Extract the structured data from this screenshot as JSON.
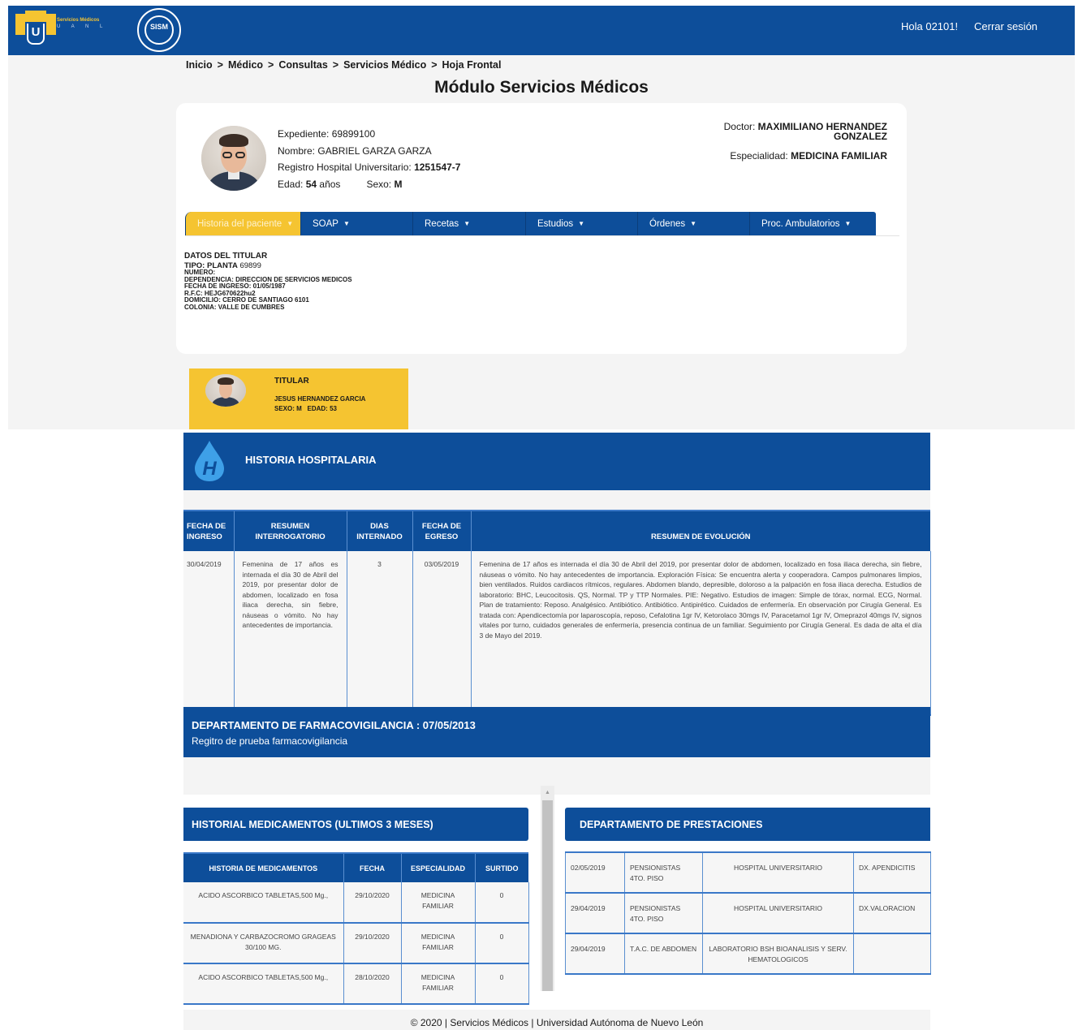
{
  "nav": {
    "logo_text": "Servicios Médicos",
    "logo_sub": "U A N L",
    "sism_logo": "SISM",
    "greeting": "Hola 02101!",
    "logout": "Cerrar sesión"
  },
  "breadcrumb": [
    "Inicio",
    "Médico",
    "Consultas",
    "Servicios Médico",
    "Hoja Frontal"
  ],
  "breadcrumb_sep": ">",
  "page_title": "Módulo Servicios Médicos",
  "patient": {
    "expediente_label": "Expediente:",
    "expediente": "69899100",
    "nombre_label": "Nombre:",
    "nombre": "GABRIEL GARZA GARZA",
    "registro_label": "Registro Hospital Universitario:",
    "registro": "1251547-7",
    "edad_label": "Edad:",
    "edad": "54",
    "edad_unit": "años",
    "sexo_label": "Sexo:",
    "sexo": "M"
  },
  "doctor": {
    "label": "Doctor:",
    "name_line1": "MAXIMILIANO HERNANDEZ",
    "name_line2": "GONZALEZ",
    "especialidad_label": "Especialidad:",
    "especialidad": "MEDICINA FAMILIAR"
  },
  "tabs": [
    {
      "label": "Historia del paciente",
      "active": true
    },
    {
      "label": "SOAP",
      "active": false
    },
    {
      "label": "Recetas",
      "active": false
    },
    {
      "label": "Estudios",
      "active": false
    },
    {
      "label": "Órdenes",
      "active": false
    },
    {
      "label": "Proc. Ambulatorios",
      "active": false
    }
  ],
  "titular_data": {
    "header": "DATOS DEL TITULAR",
    "tipo_label": "TIPO:",
    "tipo": "PLANTA",
    "tipo_num": "69899",
    "numero_label": "NUMERO:",
    "dependencia_label": "DEPENDENCIA:",
    "dependencia": "DIRECCION DE SERVICIOS MEDICOS",
    "fecha_ingreso_label": "FECHA DE INGRESO:",
    "fecha_ingreso": "01/05/1987",
    "rfc_label": "R.F.C:",
    "rfc": "HEJG670622hu2",
    "domicilio_label": "DOMICILIO:",
    "domicilio": "CERRO DE SANTIAGO 6101",
    "colonia_label": "COLONIA:",
    "colonia": "VALLE DE CUMBRES"
  },
  "titular_card": {
    "title": "TITULAR",
    "name": "JESUS HERNANDEZ GARCIA",
    "sexo_label": "SEXO:",
    "sexo": "M",
    "edad_label": "EDAD:",
    "edad": "53"
  },
  "historia_hospitalaria": {
    "title": "HISTORIA HOSPITALARIA",
    "icon_letter": "H",
    "headers": [
      "FECHA DE INGRESO",
      "RESUMEN INTERROGATORIO",
      "DIAS INTERNADO",
      "FECHA DE EGRESO",
      "RESUMEN DE EVOLUCIÓN"
    ],
    "rows": [
      {
        "fecha_ingreso": "30/04/2019",
        "resumen_interrogatorio": "Femenina de 17 años es internada el día 30 de Abril del 2019, por presentar dolor de abdomen, localizado en fosa iliaca derecha, sin fiebre, náuseas o vómito. No hay antecedentes de importancia.",
        "dias_internado": "3",
        "fecha_egreso": "03/05/2019",
        "resumen_evolucion": "Femenina de 17 años es internada el día 30 de Abril del 2019, por presentar dolor de abdomen, localizado en fosa iliaca derecha, sin fiebre, náuseas o vómito. No hay antecedentes de importancia. Exploración Física: Se encuentra alerta y cooperadora. Campos pulmonares limpios, bien ventilados. Ruidos cardiacos rítmicos, regulares. Abdomen blando, depresible, doloroso a la palpación en fosa iliaca derecha. Estudios de laboratorio: BHC, Leucocitosis. QS, Normal. TP y TTP Normales. PIE: Negativo. Estudios de imagen: Simple de tórax, normal. ECG, Normal. Plan de tratamiento: Reposo. Analgésico. Antibiótico. Antibiótico. Antipirético. Cuidados de enfermería. En observación por Cirugía General. Es tratada con: Apendicectomía por laparoscopía, reposo, Cefalotina 1gr IV, Ketorolaco 30mgs IV, Paracetamol 1gr IV, Omeprazol 40mgs IV, signos vitales por turno, cuidados generales de enfermería, presencia continua de un familiar. Seguimiento por Cirugía General. Es dada de alta el día 3 de Mayo del 2019."
      }
    ]
  },
  "farmacovigilancia": {
    "title": "DEPARTAMENTO DE FARMACOVIGILANCIA : 07/05/2013",
    "subtitle": "Regitro de prueba farmacovigilancia"
  },
  "medicamentos": {
    "title": "HISTORIAL MEDICAMENTOS (ULTIMOS 3 MESES)",
    "headers": [
      "HISTORIA DE MEDICAMENTOS",
      "FECHA",
      "ESPECIALIDAD",
      "SURTIDO"
    ],
    "rows": [
      [
        "ACIDO ASCORBICO TABLETAS,500 Mg.,",
        "29/10/2020",
        "MEDICINA FAMILIAR",
        "0"
      ],
      [
        "MENADIONA Y CARBAZOCROMO GRAGEAS 30/100 MG.",
        "29/10/2020",
        "MEDICINA FAMILIAR",
        "0"
      ],
      [
        "ACIDO ASCORBICO TABLETAS,500 Mg.,",
        "28/10/2020",
        "MEDICINA FAMILIAR",
        "0"
      ]
    ]
  },
  "prestaciones": {
    "title": "DEPARTAMENTO DE PRESTACIONES",
    "rows": [
      [
        "02/05/2019",
        "PENSIONISTAS 4TO. PISO",
        "HOSPITAL UNIVERSITARIO",
        "DX. APENDICITIS"
      ],
      [
        "29/04/2019",
        "PENSIONISTAS 4TO. PISO",
        "HOSPITAL UNIVERSITARIO",
        "DX.VALORACION"
      ],
      [
        "29/04/2019",
        "T.A.C. DE ABDOMEN",
        "LABORATORIO BSH BIOANALISIS Y SERV. HEMATOLOGICOS",
        ""
      ]
    ]
  },
  "footer": "© 2020 | Servicios Médicos | Universidad Autónoma de Nuevo León",
  "colors": {
    "primary": "#0d4e9a",
    "accent": "#f5c431",
    "background": "#f4f4f4"
  }
}
